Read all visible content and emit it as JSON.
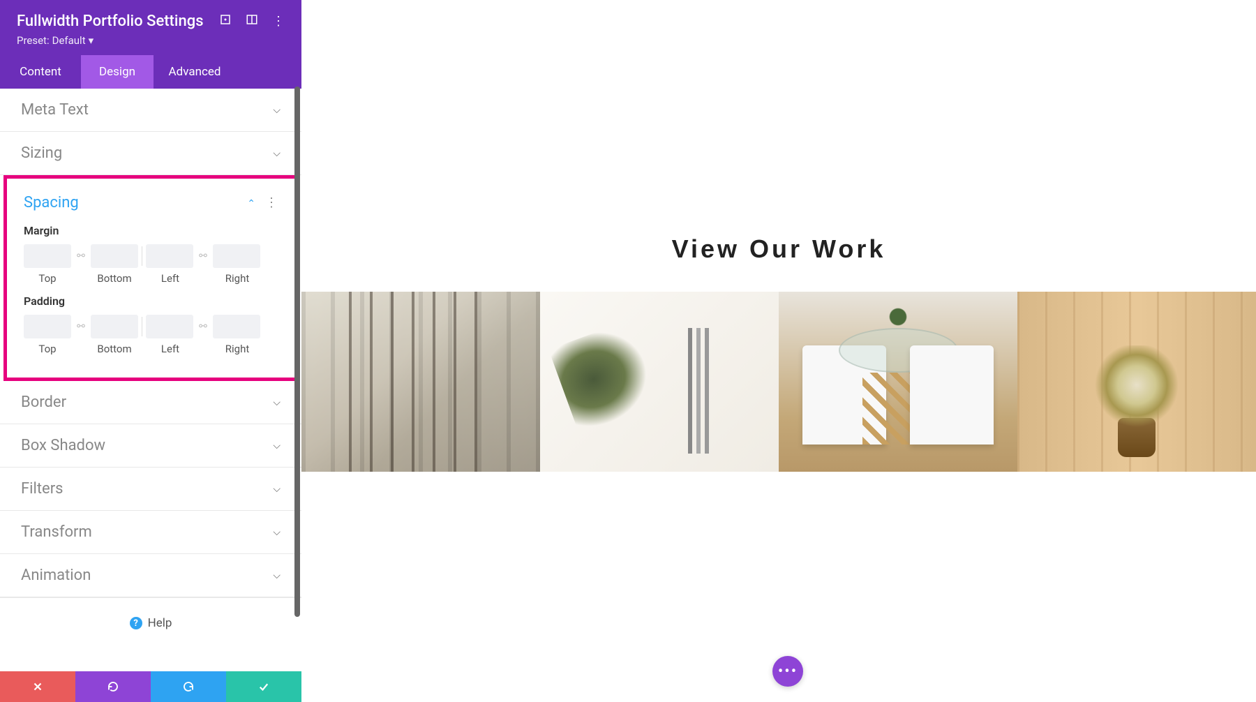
{
  "sidebar": {
    "title": "Fullwidth Portfolio Settings",
    "preset_label": "Preset:",
    "preset_value": "Default"
  },
  "tabs": {
    "content": "Content",
    "design": "Design",
    "advanced": "Advanced"
  },
  "sections": {
    "meta_text": "Meta Text",
    "sizing": "Sizing",
    "spacing": "Spacing",
    "border": "Border",
    "box_shadow": "Box Shadow",
    "filters": "Filters",
    "transform": "Transform",
    "animation": "Animation"
  },
  "spacing": {
    "margin_label": "Margin",
    "padding_label": "Padding",
    "sides": {
      "top": "Top",
      "bottom": "Bottom",
      "left": "Left",
      "right": "Right"
    }
  },
  "help_label": "Help",
  "canvas": {
    "heading": "View Our Work"
  }
}
